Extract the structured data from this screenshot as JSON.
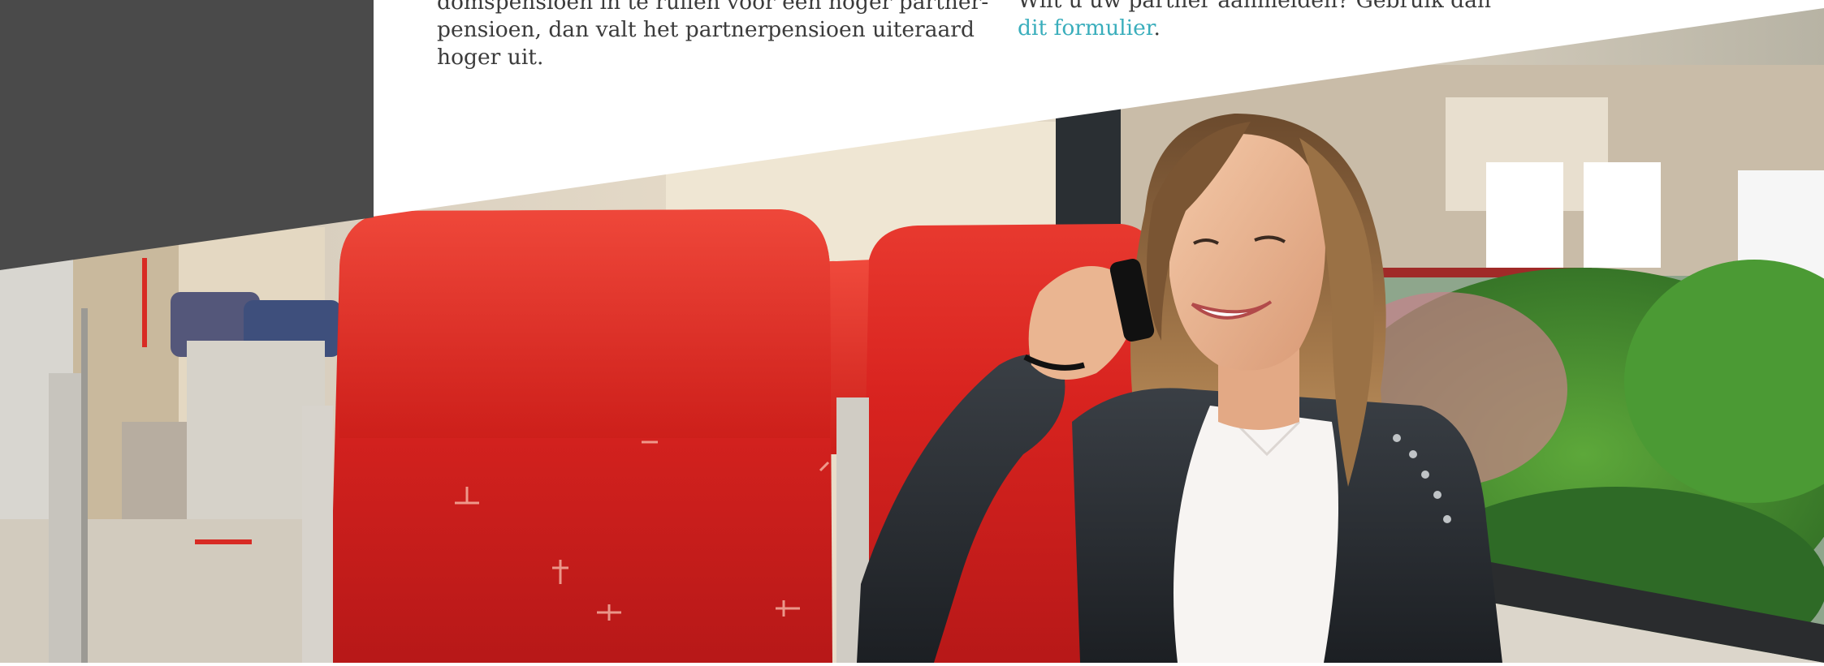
{
  "left_column": {
    "lines": [
      "domspensioen in te ruilen voor een hoger partner-",
      "pensioen, dan valt het partnerpensioen uiteraard",
      "hoger uit."
    ]
  },
  "right_column": {
    "line1": "Wilt u uw partner aanmelden? Gebruik dan",
    "link_text": "dit formulier",
    "after_link": "."
  },
  "colors": {
    "sidebar_gray": "#4a4a4a",
    "link": "#3aaebc",
    "body_text": "#3b3b3b",
    "seat_red": "#d8231f"
  },
  "photo": {
    "subject": "woman-on-phone-in-train"
  }
}
